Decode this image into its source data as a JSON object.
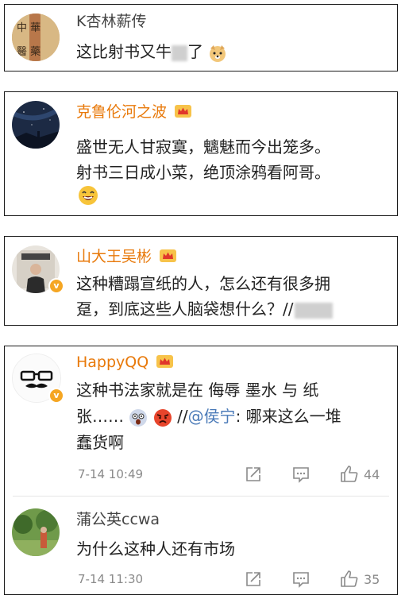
{
  "comments": [
    {
      "username": "K杏林薪传",
      "text_before": "这比射书又牛",
      "text_after": "了",
      "avatar_text_1": "中 華",
      "avatar_text_2": "醫 藥"
    },
    {
      "username": "克鲁伦河之波",
      "line1": "盛世无人甘寂寞，魑魅而今出笼多。",
      "line2": "射书三日成小菜，绝顶涂鸦看阿哥。"
    },
    {
      "username": "山大王吴彬",
      "line1": "这种糟蹋宣纸的人，怎么还有很多拥",
      "line2": "趸，到底这些人脑袋想什么？//"
    },
    {
      "username": "HappyQQ",
      "line1": "这种书法家就是在 侮辱 墨水 与 纸",
      "line2_before": "张……",
      "line2_slashes": "//",
      "mention": "@侯宁",
      "line2_after": ": 哪来这么一堆",
      "line3": "蠢货啊",
      "time": "7-14 10:49",
      "like_count": "44"
    },
    {
      "username": "蒲公英ccwa",
      "text": "为什么这种人还有市场",
      "time": "7-14 11:30",
      "like_count": "35"
    }
  ],
  "colors": {
    "vip_name": "#e8790a",
    "mention": "#4a7ab8",
    "meta": "#8a8a8a",
    "badge": "#f5a623"
  },
  "icons": [
    "crown-icon",
    "verified-badge-icon",
    "share-icon",
    "comment-icon",
    "like-icon",
    "doge-emoji",
    "laugh-emoji",
    "scared-emoji",
    "angry-emoji"
  ]
}
